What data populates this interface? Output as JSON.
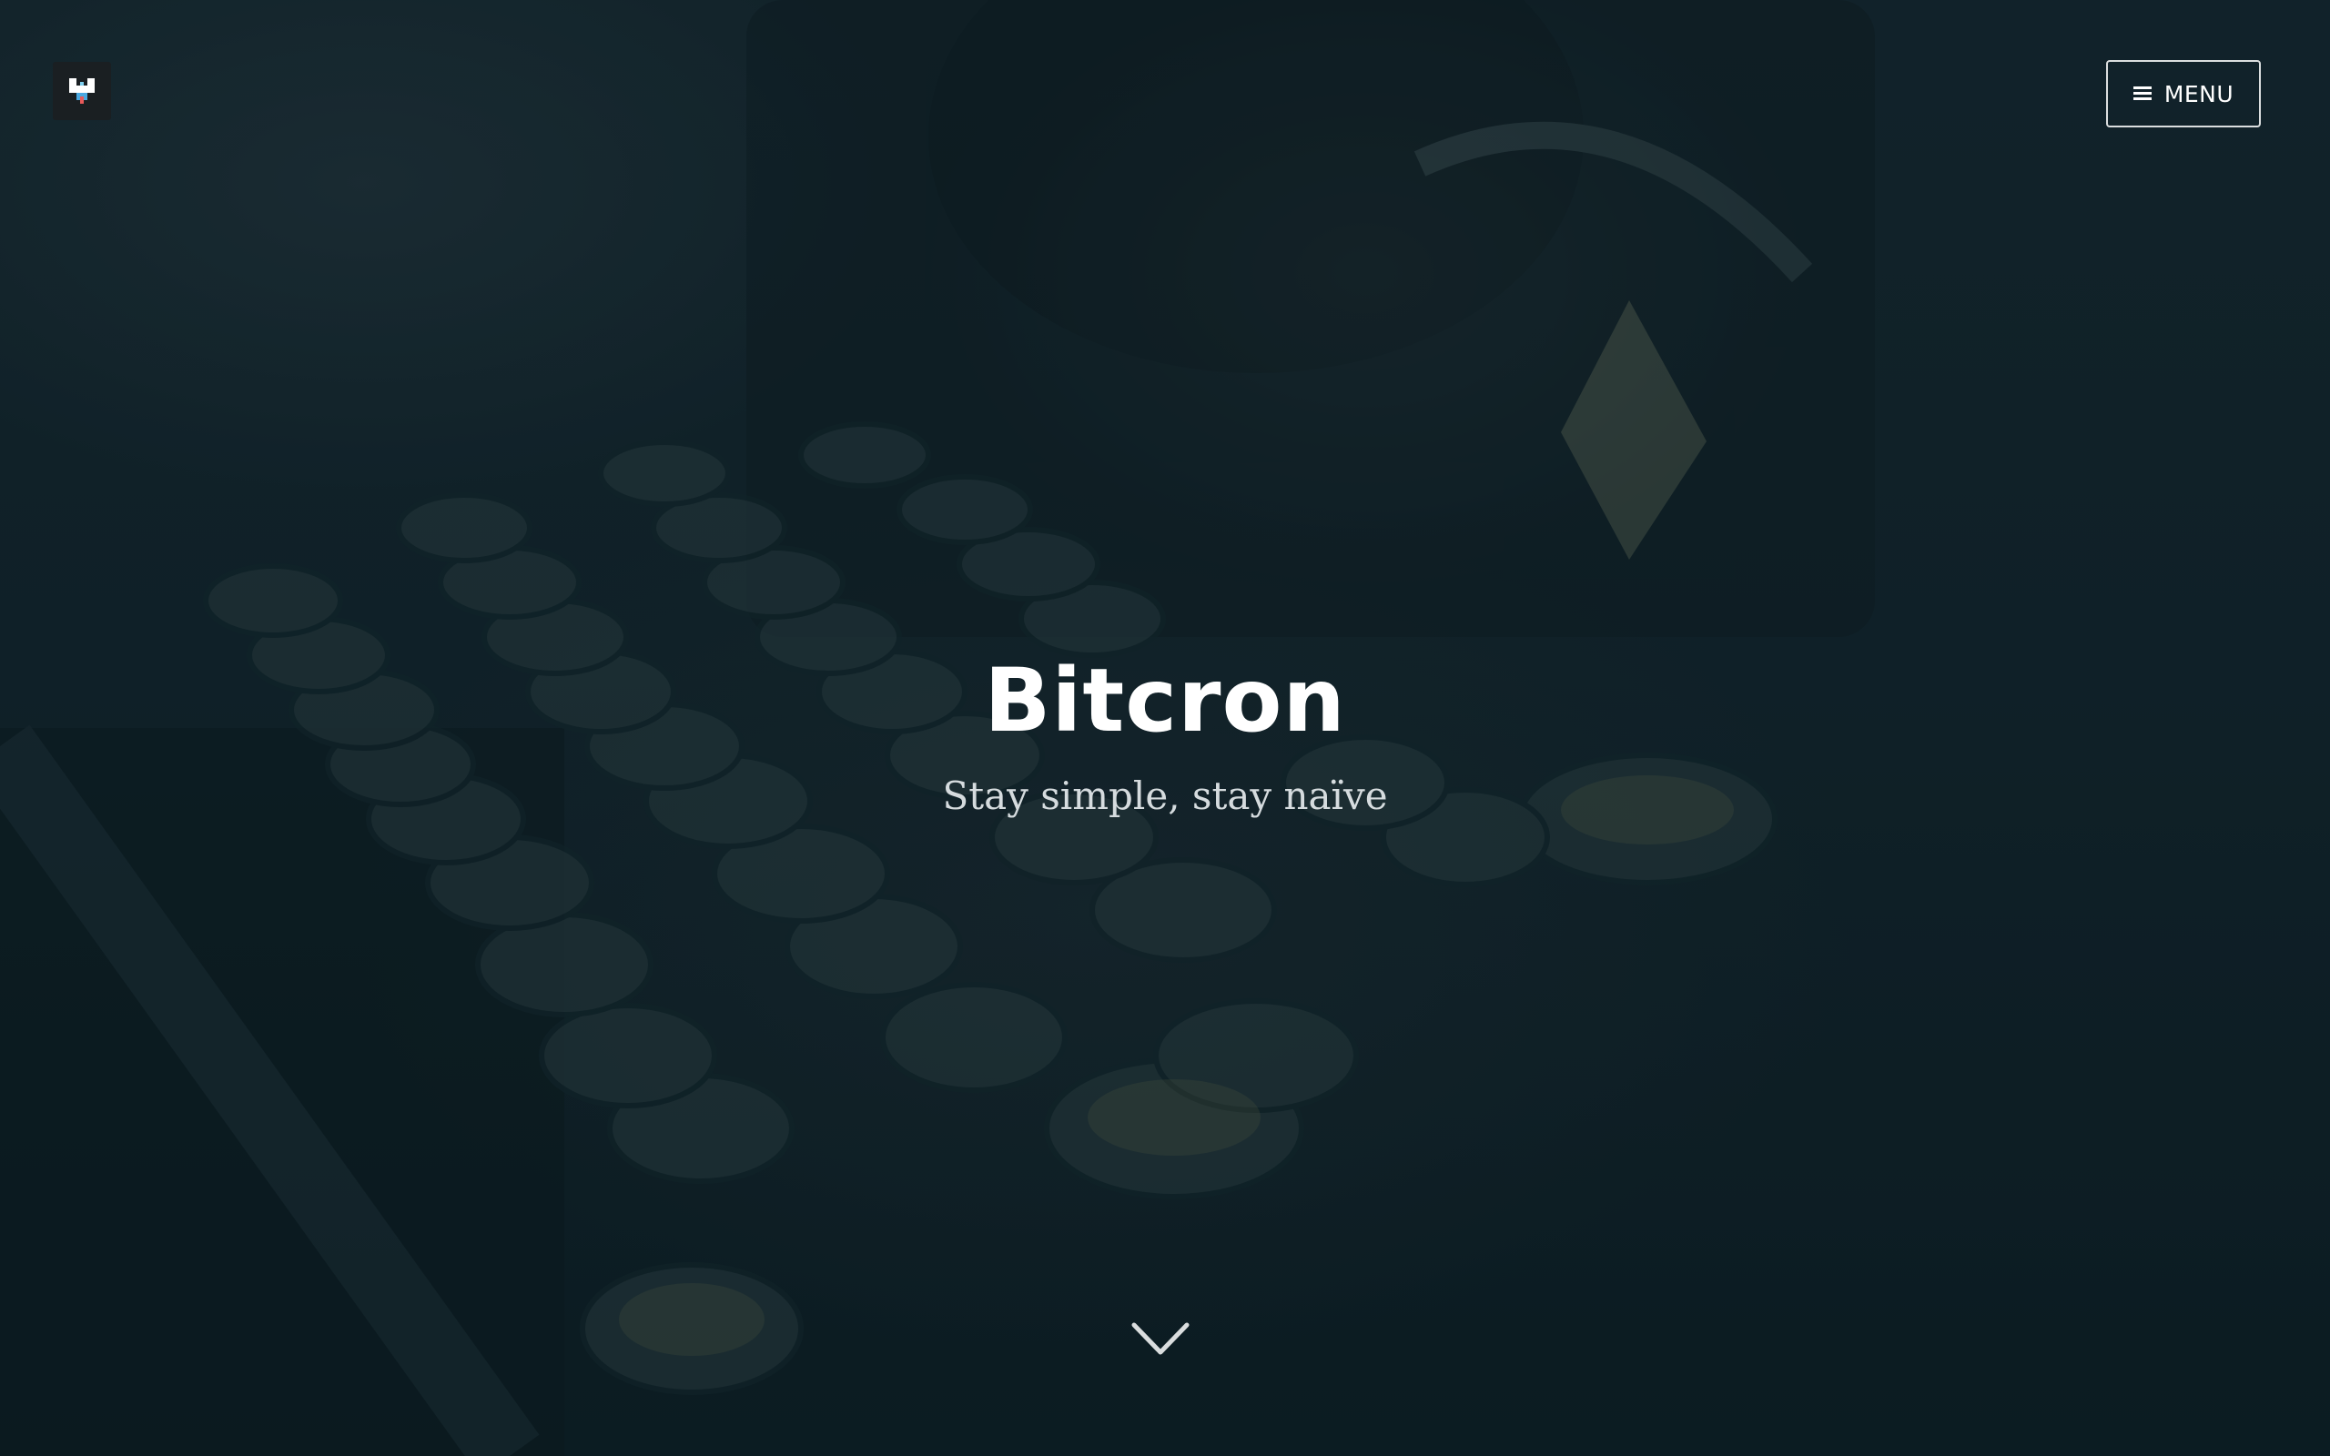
{
  "header": {
    "logo_icon": "pixel-logo-icon",
    "menu_label": "MENU",
    "menu_icon": "hamburger-icon"
  },
  "hero": {
    "title": "Bitcron",
    "tagline": "Stay simple, stay naïve",
    "scroll_icon": "chevron-down-icon",
    "background": "typewriter-photo"
  },
  "colors": {
    "overlay": "#0f2027",
    "text": "#ffffff"
  }
}
